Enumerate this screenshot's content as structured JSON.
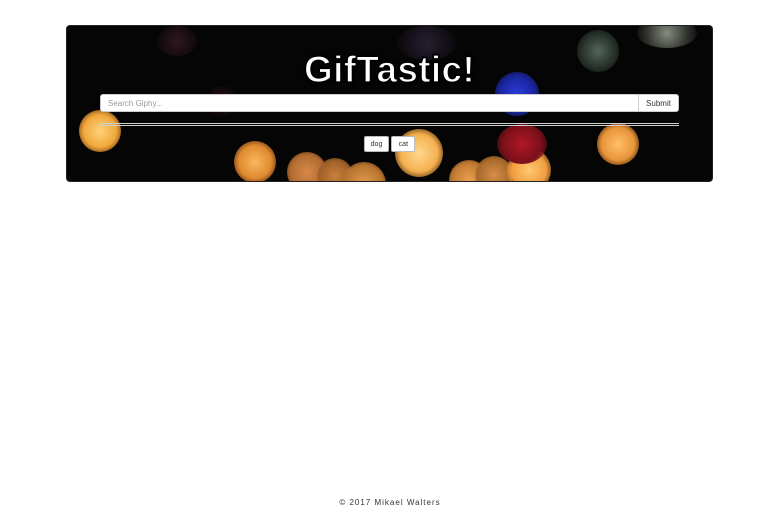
{
  "header": {
    "title": "GifTastic!"
  },
  "search": {
    "placeholder": "Search Giphy...",
    "value": "",
    "submit_label": "Submit"
  },
  "tags": [
    {
      "label": "dog"
    },
    {
      "label": "cat"
    }
  ],
  "footer": {
    "text": "© 2017 Mikael Walters"
  },
  "colors": {
    "hero_background": "#050505",
    "bokeh_orange": "#f5a742",
    "bokeh_blue": "#2030c0",
    "bokeh_red": "#c01828"
  }
}
